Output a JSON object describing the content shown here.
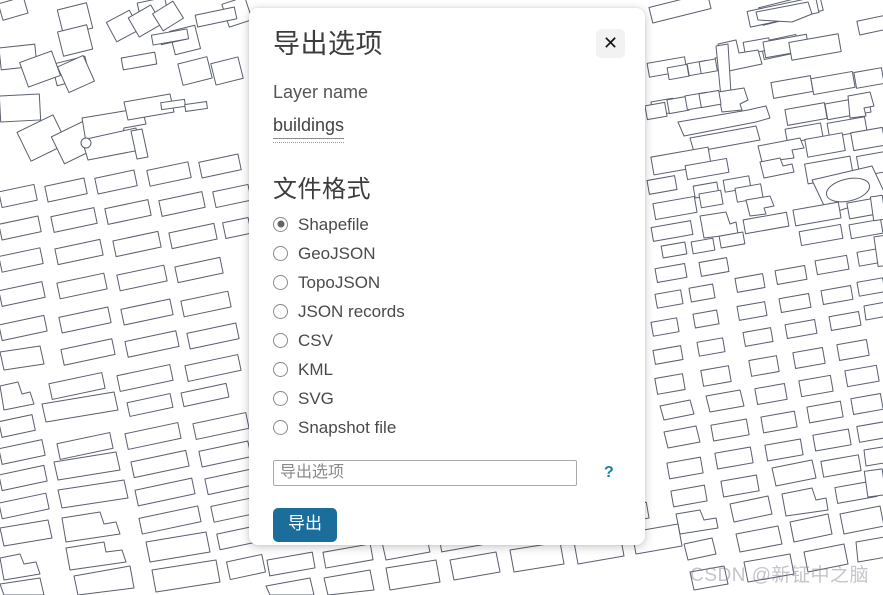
{
  "background": {
    "type": "map-building-footprints",
    "description": "city building footprint outlines",
    "stroke_color": "#5a5f6e",
    "fill_color": "#ffffff"
  },
  "watermark": {
    "text": "CSDN @新钲中之脑"
  },
  "dialog": {
    "title": "导出选项",
    "close_label": "✕",
    "layer": {
      "label": "Layer name",
      "value": "buildings"
    },
    "format": {
      "heading": "文件格式",
      "selected": "Shapefile",
      "options": [
        {
          "label": "Shapefile",
          "selected": true
        },
        {
          "label": "GeoJSON",
          "selected": false
        },
        {
          "label": "TopoJSON",
          "selected": false
        },
        {
          "label": "JSON records",
          "selected": false
        },
        {
          "label": "CSV",
          "selected": false
        },
        {
          "label": "KML",
          "selected": false
        },
        {
          "label": "SVG",
          "selected": false
        },
        {
          "label": "Snapshot file",
          "selected": false
        }
      ]
    },
    "options_input": {
      "value": "",
      "placeholder": "导出选项"
    },
    "help_label": "?",
    "export_label": "导出",
    "accent_color": "#1b6e9c",
    "link_color": "#1b7fa8"
  }
}
